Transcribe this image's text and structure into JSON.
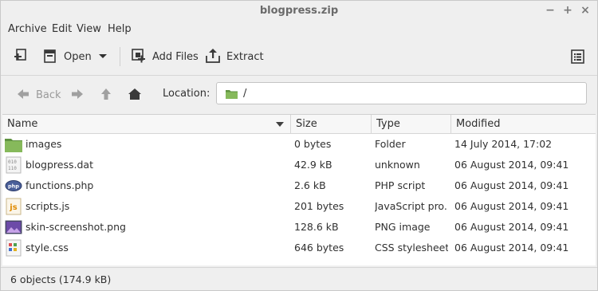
{
  "window": {
    "title": "blogpress.zip",
    "minimize_glyph": "−",
    "maximize_glyph": "+",
    "close_glyph": "×"
  },
  "menubar": {
    "items": [
      {
        "label": "Archive"
      },
      {
        "label": "Edit"
      },
      {
        "label": "View"
      },
      {
        "label": "Help"
      }
    ]
  },
  "toolbar": {
    "open_label": "Open",
    "add_files_label": "Add Files",
    "extract_label": "Extract"
  },
  "navigation": {
    "back_label": "Back",
    "location_label": "Location:",
    "location_value": "/"
  },
  "file_list": {
    "columns": {
      "name": "Name",
      "size": "Size",
      "type": "Type",
      "modified": "Modified"
    },
    "sort_column": "Name",
    "rows": [
      {
        "icon": "folder-icon",
        "name": "images",
        "size": "0 bytes",
        "type": "Folder",
        "modified": "14 July 2014, 17:02"
      },
      {
        "icon": "binary-file-icon",
        "name": "blogpress.dat",
        "size": "42.9 kB",
        "type": "unknown",
        "modified": "06 August 2014, 09:41"
      },
      {
        "icon": "php-file-icon",
        "name": "functions.php",
        "size": "2.6 kB",
        "type": "PHP script",
        "modified": "06 August 2014, 09:41"
      },
      {
        "icon": "js-file-icon",
        "name": "scripts.js",
        "size": "201 bytes",
        "type": "JavaScript pro...",
        "modified": "06 August 2014, 09:41"
      },
      {
        "icon": "image-file-icon",
        "name": "skin-screenshot.png",
        "size": "128.6 kB",
        "type": "PNG image",
        "modified": "06 August 2014, 09:41"
      },
      {
        "icon": "css-file-icon",
        "name": "style.css",
        "size": "646 bytes",
        "type": "CSS stylesheet",
        "modified": "06 August 2014, 09:41"
      }
    ]
  },
  "statusbar": {
    "text": "6 objects (174.9 kB)"
  },
  "colors": {
    "window_bg": "#efefef",
    "list_bg": "#ffffff",
    "folder_green": "#7bb253",
    "text": "#303030",
    "disabled_text": "#9a9a9a"
  }
}
